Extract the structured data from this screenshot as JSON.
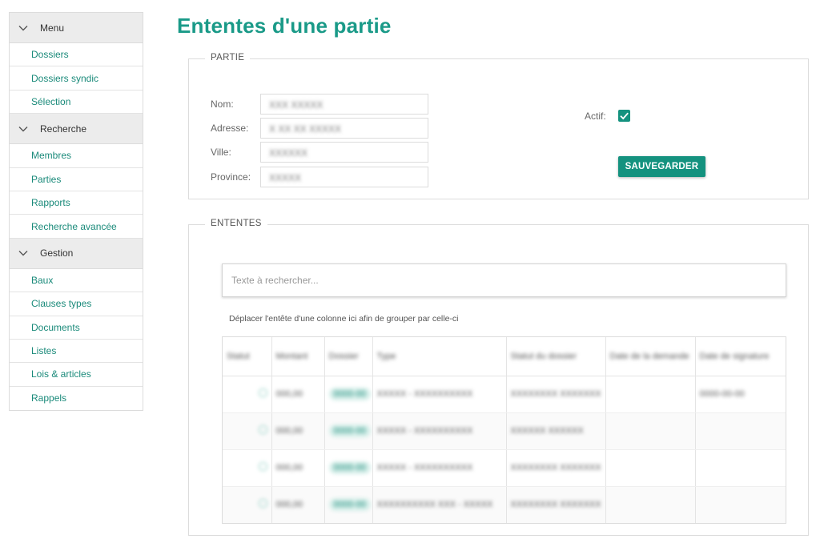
{
  "sidebar": {
    "sections": [
      {
        "title": "Menu",
        "items": [
          "Dossiers",
          "Dossiers syndic",
          "Sélection"
        ]
      },
      {
        "title": "Recherche",
        "items": [
          "Membres",
          "Parties",
          "Rapports",
          "Recherche avancée"
        ]
      },
      {
        "title": "Gestion",
        "items": [
          "Baux",
          "Clauses types",
          "Documents",
          "Listes",
          "Lois & articles",
          "Rappels"
        ]
      }
    ]
  },
  "page": {
    "title": "Ententes d'une partie"
  },
  "partie": {
    "legend": "PARTIE",
    "labels": {
      "nom": "Nom:",
      "adresse": "Adresse:",
      "ville": "Ville:",
      "province": "Province:",
      "actif": "Actif:"
    },
    "values": {
      "nom": "XXX XXXXX",
      "adresse": "X XX XX XXXXX",
      "ville": "XXXXXX",
      "province": "XXXXX"
    },
    "actif_checked": true,
    "save_label": "SAUVEGARDER"
  },
  "ententes": {
    "legend": "ENTENTES",
    "search_placeholder": "Texte à rechercher...",
    "group_hint": "Déplacer l'entête d'une colonne ici afin de grouper par celle-ci",
    "columns": [
      "Statut",
      "Montant",
      "Dossier",
      "Type",
      "Statut du dossier",
      "Date de la demande",
      "Date de signature"
    ],
    "rows": [
      [
        "",
        "000,00",
        "0000-00",
        "XXXXX - XXXXXXXXXX",
        "XXXXXXXX XXXXXXX",
        "",
        "0000-00-00"
      ],
      [
        "",
        "000,00",
        "0000-00",
        "XXXXX - XXXXXXXXXX",
        "XXXXXX XXXXXX",
        "",
        ""
      ],
      [
        "",
        "000,00",
        "0000-00",
        "XXXXX - XXXXXXXXXX",
        "XXXXXXXX XXXXXXX",
        "",
        ""
      ],
      [
        "",
        "000,00",
        "0000-00",
        "XXXXXXXXXX XXX - XXXXX",
        "XXXXXXXX XXXXXXX",
        "",
        ""
      ]
    ]
  },
  "colors": {
    "accent": "#14927f",
    "title": "#1a9a88",
    "link": "#1a8a7a"
  }
}
